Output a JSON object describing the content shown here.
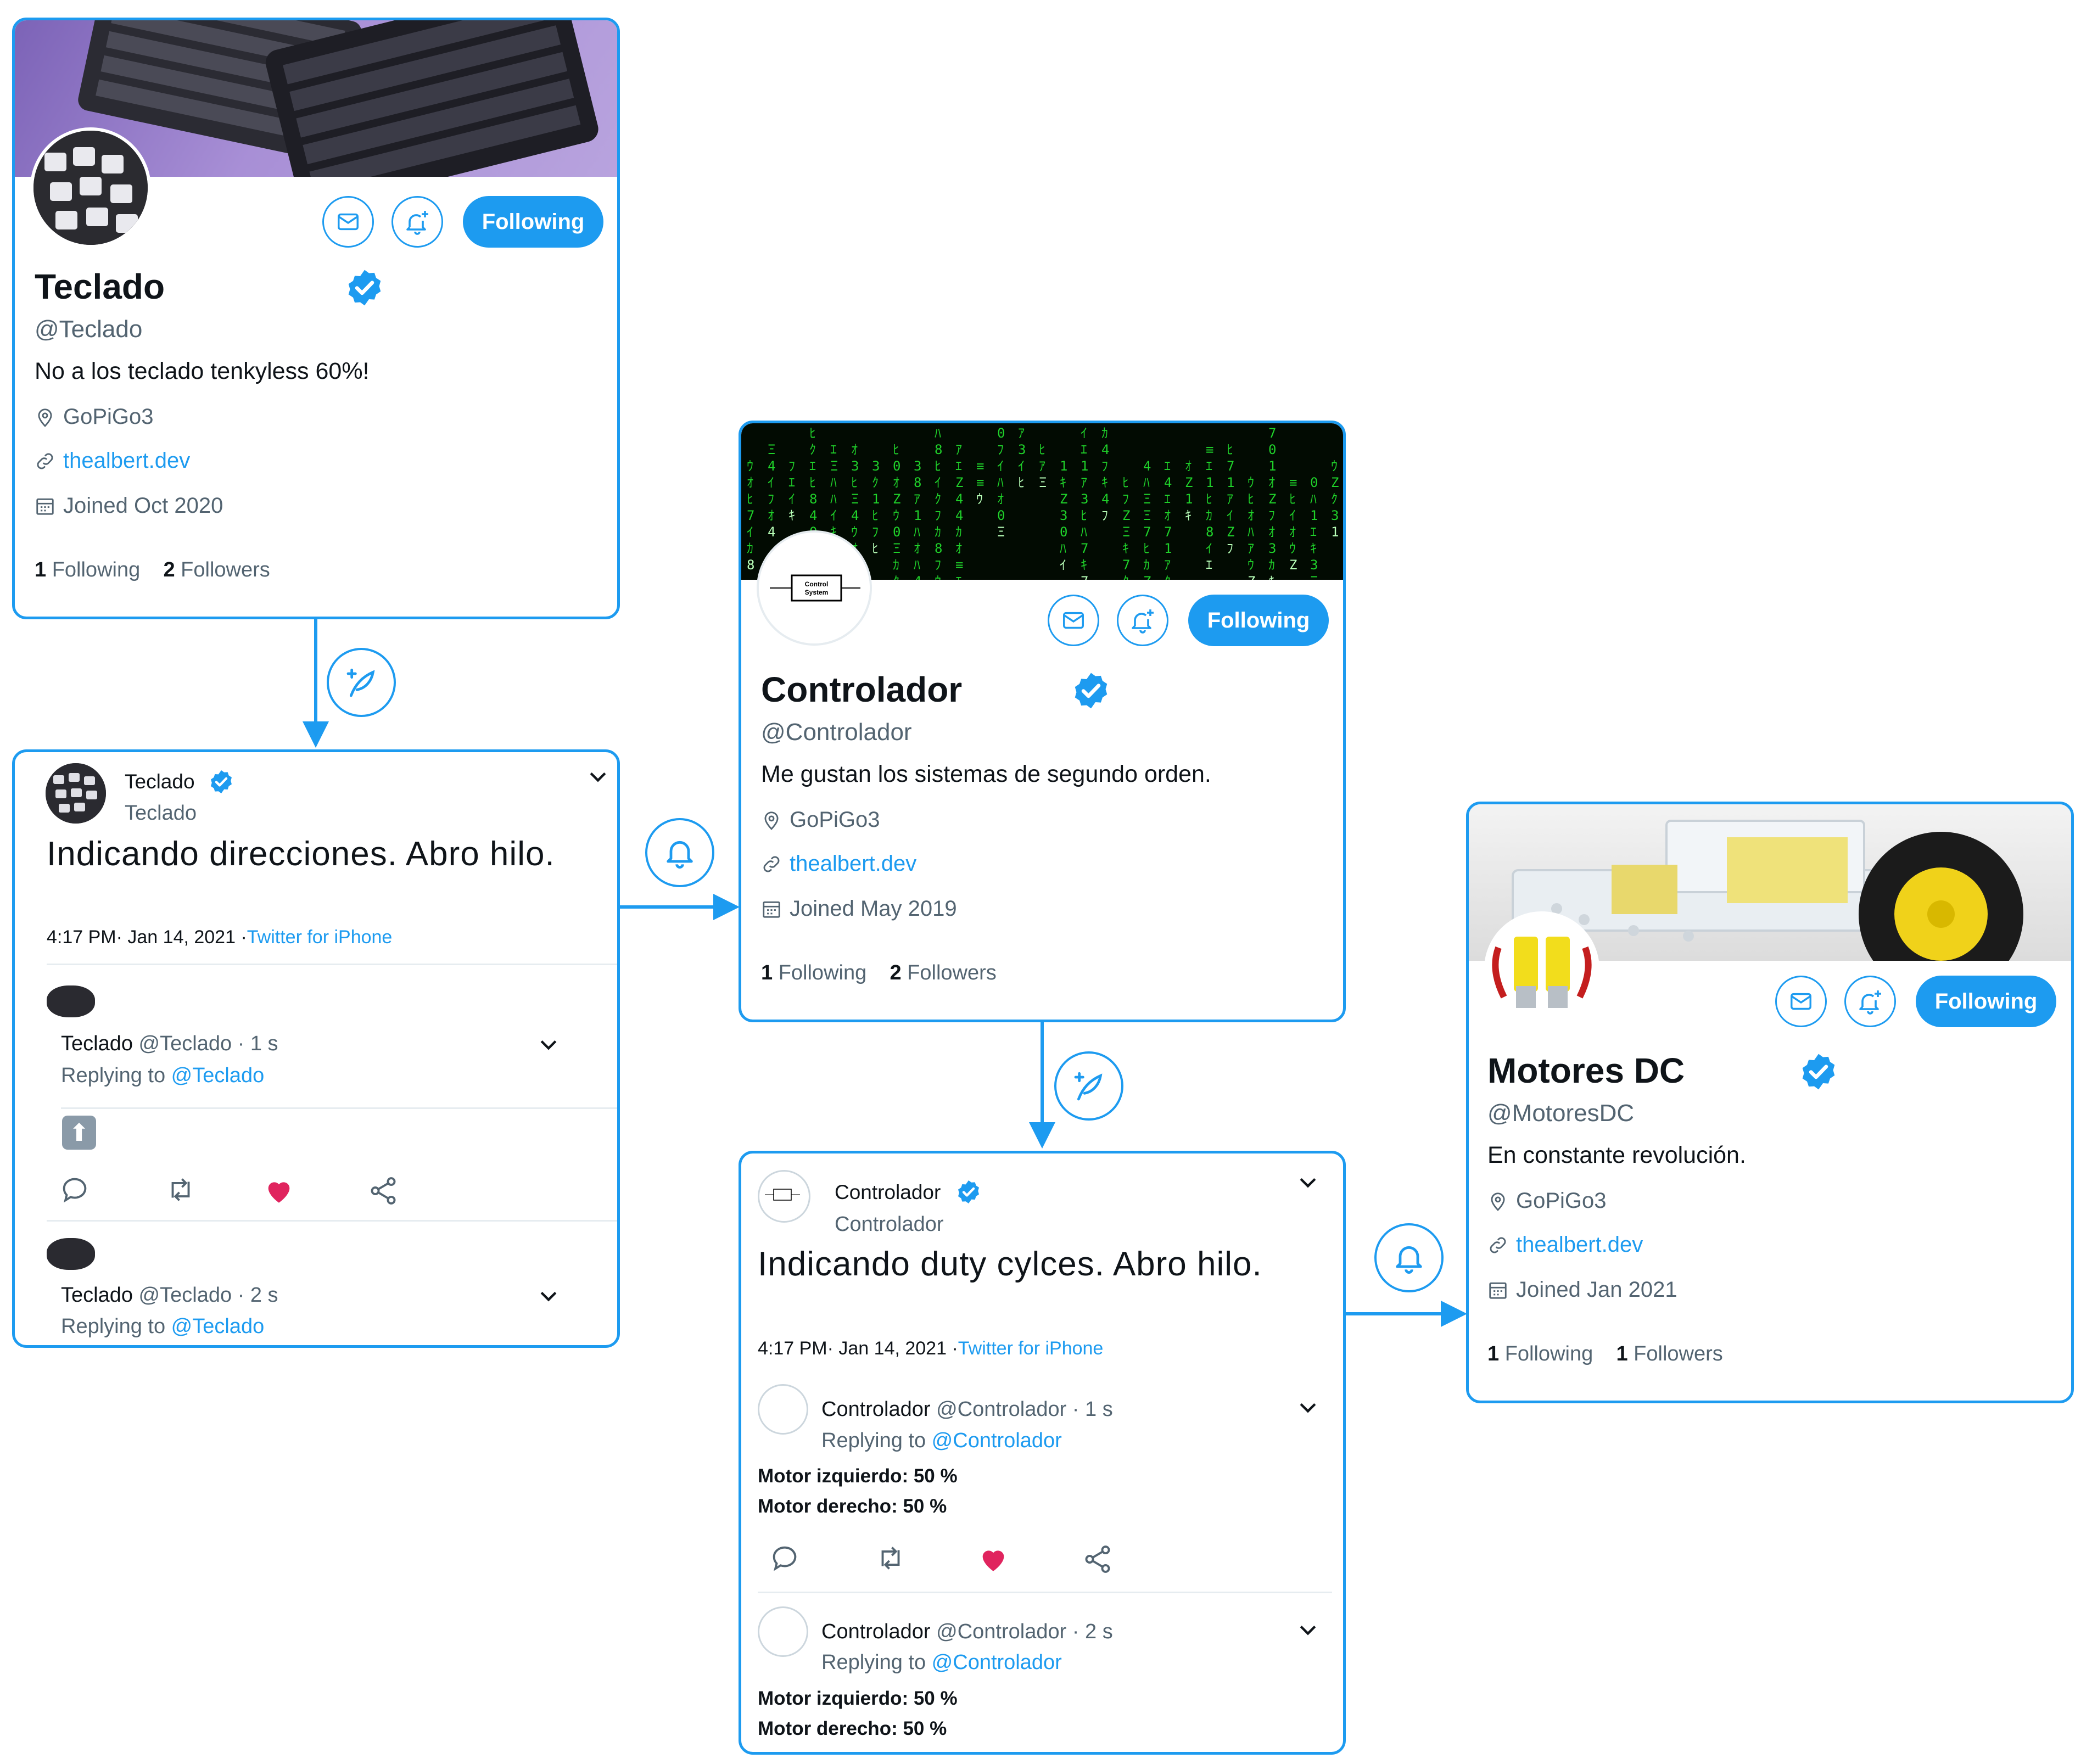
{
  "colors": {
    "accent": "#1d9bf0",
    "like": "#e0245e",
    "text": "#0f1419",
    "muted": "#536471"
  },
  "profiles": {
    "teclado": {
      "name": "Teclado",
      "handle": "@Teclado",
      "bio": "No a los teclado tenkyless 60%!",
      "location": "GoPiGo3",
      "website": "thealbert.dev",
      "joined": "Joined Oct 2020",
      "following_count": "1",
      "following_label": "Following",
      "followers_count": "2",
      "followers_label": "Followers",
      "follow_button": "Following"
    },
    "controlador": {
      "name": "Controlador",
      "handle": "@Controlador",
      "bio": "Me gustan los sistemas de segundo orden.",
      "location": "GoPiGo3",
      "website": "thealbert.dev",
      "joined": "Joined May 2019",
      "following_count": "1",
      "following_label": "Following",
      "followers_count": "2",
      "followers_label": "Followers",
      "follow_button": "Following",
      "avatar_text_1": "Control",
      "avatar_text_2": "System"
    },
    "motores": {
      "name": "Motores DC",
      "handle": "@MotoresDC",
      "bio": "En constante revolución.",
      "location": "GoPiGo3",
      "website": "thealbert.dev",
      "joined": "Joined Jan 2021",
      "following_count": "1",
      "following_label": "Following",
      "followers_count": "1",
      "followers_label": "Followers",
      "follow_button": "Following"
    }
  },
  "tweets": {
    "teclado": {
      "author": "Teclado",
      "sub": "Teclado",
      "text": "Indicando direcciones. Abro hilo.",
      "date": "4:17 PM· Jan 14, 2021 ·",
      "source": "Twitter for iPhone",
      "replies": [
        {
          "name": "Teclado",
          "meta": " @Teclado · 1 s",
          "replying": "Replying to ",
          "mention": "@Teclado",
          "content": "⬆"
        },
        {
          "name": "Teclado",
          "meta": " @Teclado · 2 s",
          "replying": "Replying to ",
          "mention": "@Teclado"
        }
      ]
    },
    "controlador": {
      "author": "Controlador",
      "sub": "Controlador",
      "text": "Indicando duty cylces. Abro hilo.",
      "date": "4:17 PM· Jan 14, 2021 ·",
      "source": "Twitter for iPhone",
      "replies": [
        {
          "name": "Controlador",
          "meta": " @Controlador · 1 s",
          "replying": "Replying to ",
          "mention": "@Controlador",
          "line1": "Motor izquierdo: 50 %",
          "line2": "Motor derecho: 50 %"
        },
        {
          "name": "Controlador",
          "meta": " @Controlador · 2 s",
          "replying": "Replying to ",
          "mention": "@Controlador",
          "line1": "Motor izquierdo: 50 %",
          "line2": "Motor derecho: 50 %"
        }
      ]
    }
  },
  "icons": {
    "message": "envelope-icon",
    "notify": "bell-plus-icon",
    "location": "map-pin-icon",
    "link": "link-icon",
    "calendar": "calendar-icon",
    "verified": "verified-badge-icon",
    "compose": "compose-feather-icon",
    "bell": "bell-icon",
    "reply": "reply-icon",
    "retweet": "retweet-icon",
    "like": "heart-icon",
    "share": "share-icon"
  }
}
